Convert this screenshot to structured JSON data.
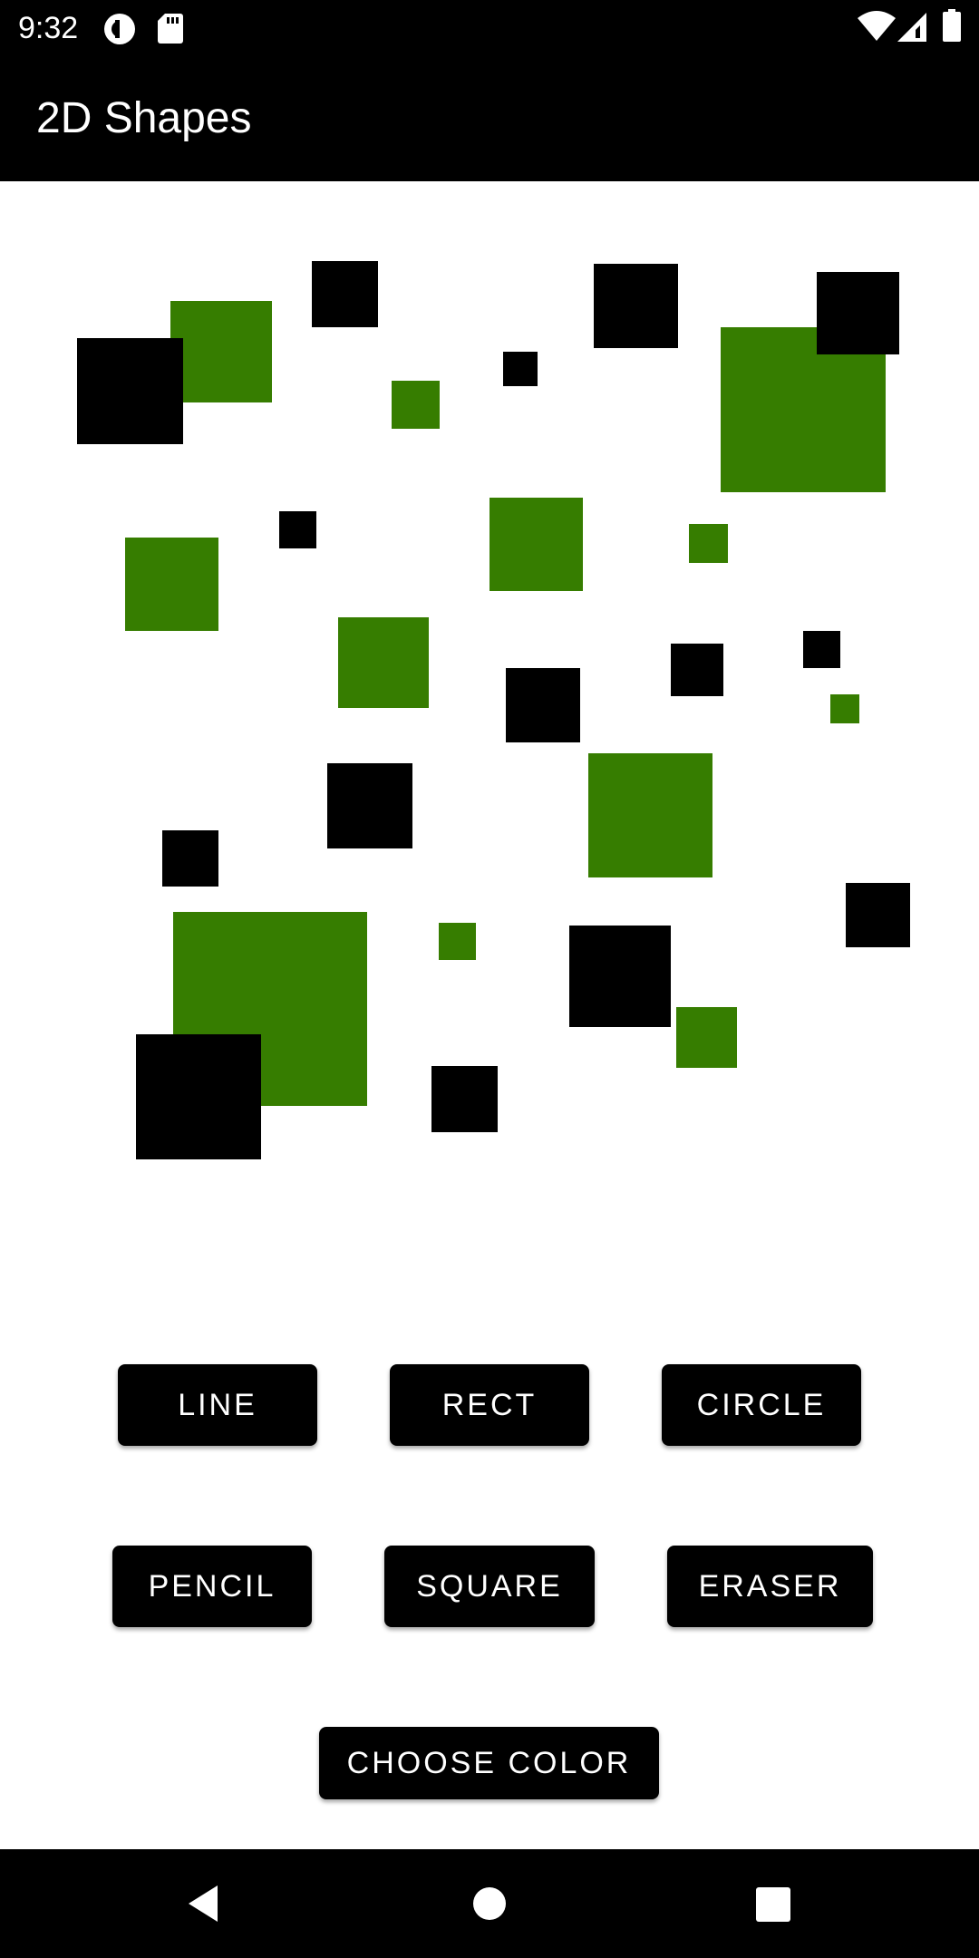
{
  "status_bar": {
    "time": "9:32",
    "left_icons": [
      "pocket-casts-icon",
      "sd-card-icon"
    ],
    "right_icons": [
      "wifi-icon",
      "cellular-signal-icon",
      "battery-icon"
    ]
  },
  "app_bar": {
    "title": "2D Shapes"
  },
  "canvas": {
    "colors": {
      "green": "#367d00",
      "black": "#000000"
    }
  },
  "buttons": {
    "line": "LINE",
    "rect": "RECT",
    "circle": "CIRCLE",
    "pencil": "PENCIL",
    "square": "SQUARE",
    "eraser": "ERASER",
    "choose_color": "CHOOSE COLOR"
  },
  "nav_bar": {
    "icons": [
      "back-icon",
      "home-icon",
      "recents-icon"
    ]
  },
  "colors": {
    "bar_background": "#000000",
    "accent_green": "#367d00",
    "button_background": "#000000",
    "button_text": "#ffffff"
  }
}
